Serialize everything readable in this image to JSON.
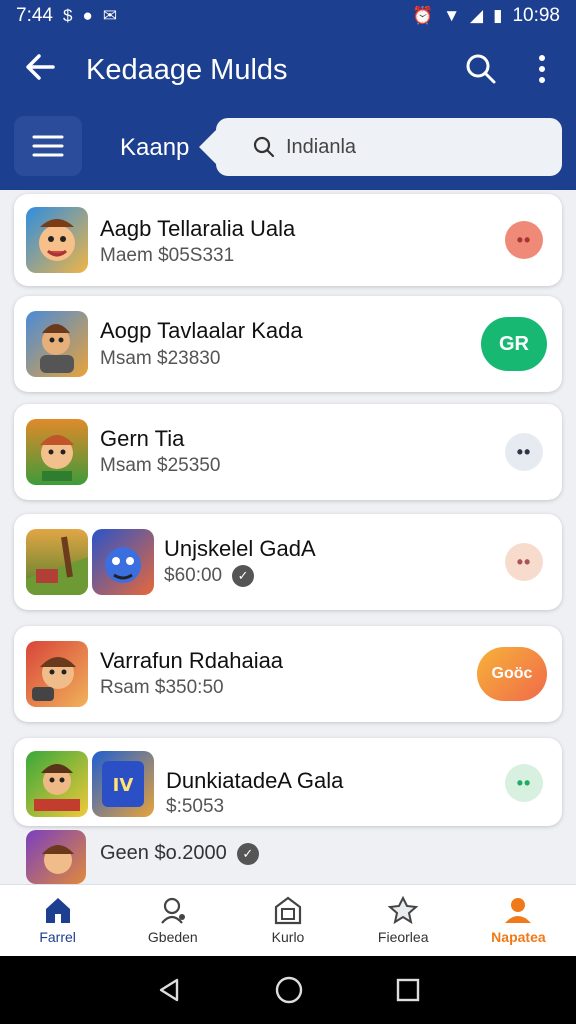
{
  "status": {
    "time": "7:44",
    "clock_right": "10:98"
  },
  "appbar": {
    "title": "Kedaage Mulds"
  },
  "subbar": {
    "category": "Kaanp",
    "search_value": "Indianla"
  },
  "items": [
    {
      "title": "Aagb Tellaralia Uala",
      "subtitle": "Maem $05S331",
      "action_label": "",
      "action_color": "#f08a78"
    },
    {
      "title": "Aogp Tavlaalar Kada",
      "subtitle": "Msam $23830",
      "action_label": "GR",
      "action_color": "#16b872"
    },
    {
      "title": "Gern Tia",
      "subtitle": "Msam $25350",
      "action_label": "",
      "action_color": "#e6ebf2"
    },
    {
      "title": "Unjskelel GadA",
      "subtitle": "$60:00",
      "action_label": "",
      "action_color": "#f7dccd"
    },
    {
      "title": "Varrafun Rdahaiaa",
      "subtitle": "Rsam $350:50",
      "action_label": "Goöc",
      "action_color": "#f58a3a"
    },
    {
      "title": "DunkiatadeA Gala",
      "subtitle": "$:5053",
      "action_label": "",
      "action_color": "#d7f0df"
    },
    {
      "title": "",
      "subtitle": "Geen $o.2000",
      "action_label": "",
      "action_color": ""
    }
  ],
  "bottom_nav": [
    {
      "label": "Farrel",
      "icon": "home-icon"
    },
    {
      "label": "Gbeden",
      "icon": "user-pin-icon"
    },
    {
      "label": "Kurlo",
      "icon": "store-icon"
    },
    {
      "label": "Fieorlea",
      "icon": "star-house-icon"
    },
    {
      "label": "Napatea",
      "icon": "profile-icon"
    }
  ],
  "colors": {
    "primary": "#1d3f8f",
    "accent_orange": "#f07a1a",
    "green": "#16b872"
  }
}
